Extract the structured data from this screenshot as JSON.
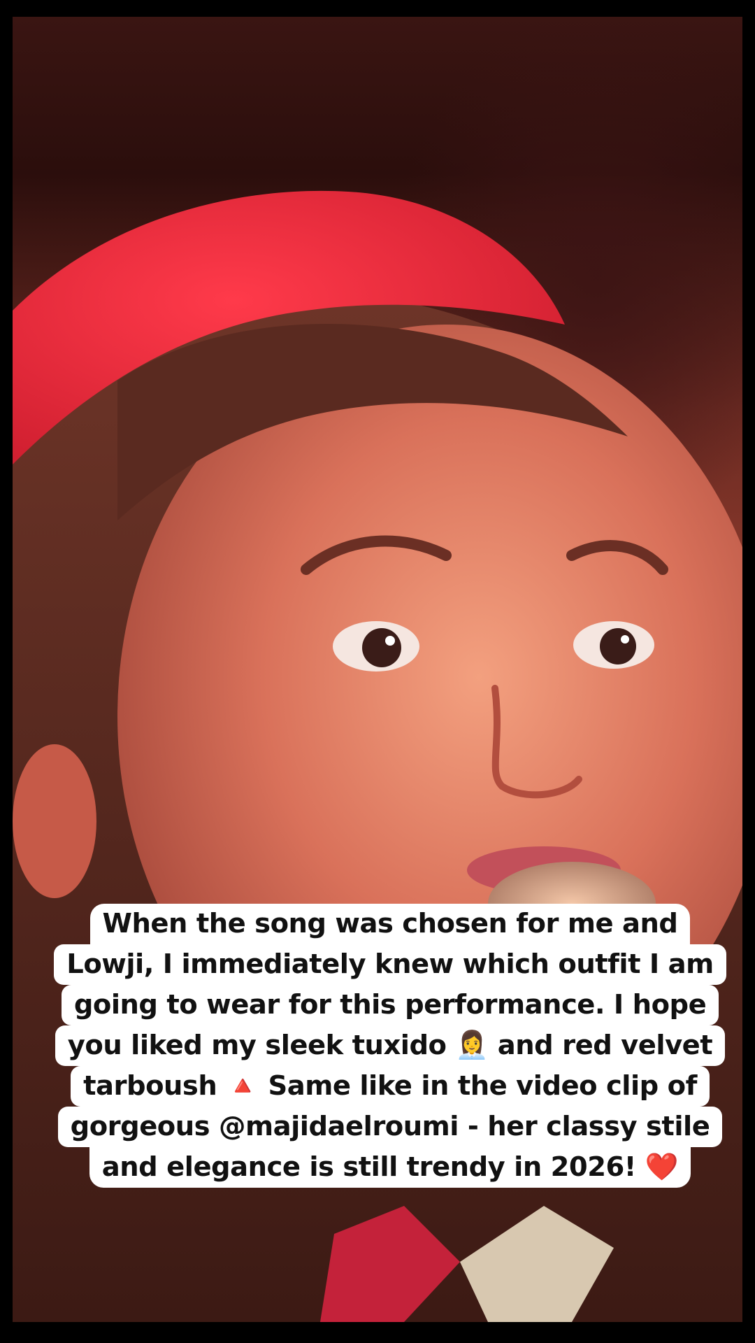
{
  "caption": {
    "lines": [
      "When the song was chosen for me and",
      "Lowji, I immediately knew which outfit I am",
      "going to wear for this performance. I hope",
      "you liked my sleek tuxido 👩‍💼 and red velvet",
      "tarboush  🔺 Same like in the video clip of",
      "gorgeous @majidaelroumi - her classy stile",
      "and elegance is still trendy in 2026! ❤️"
    ]
  },
  "colors": {
    "caption_bg": "#ffffff",
    "caption_text": "#111111",
    "tarboush": "#e8283a",
    "frame": "#000000"
  }
}
